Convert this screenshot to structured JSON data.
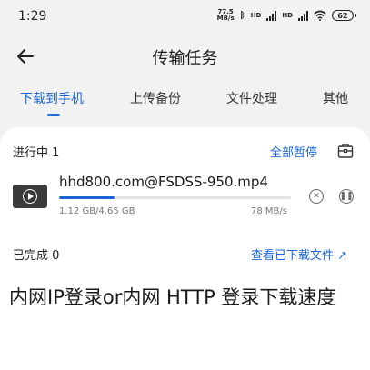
{
  "status_bar": {
    "time": "1:29",
    "net_speed_top": "77.5",
    "net_speed_bottom": "MB/s",
    "hd1": "HD",
    "hd2": "HD",
    "battery": "62"
  },
  "header": {
    "title": "传输任务",
    "back_icon": "arrow-left-icon"
  },
  "tabs": [
    {
      "label": "下载到手机",
      "active": true
    },
    {
      "label": "上传备份",
      "active": false
    },
    {
      "label": "文件处理",
      "active": false
    },
    {
      "label": "其他",
      "active": false
    }
  ],
  "in_progress": {
    "label": "进行中 1",
    "pause_all": "全部暂停",
    "toolbox_icon": "toolbox-icon"
  },
  "task": {
    "file_name": "hhd800.com@FSDSS-950.mp4",
    "size": "1.12 GB/4.65 GB",
    "speed": "78 MB/s",
    "progress": 0.241,
    "cancel_icon": "close-circle-icon",
    "pause_icon": "pause-circle-icon"
  },
  "completed": {
    "label": "已完成 0",
    "view_link": "查看已下载文件 ↗"
  },
  "caption": "内网IP登录or内网 HTTP 登录下载速度",
  "colors": {
    "accent": "#1a66d9",
    "background": "#f2f2f2",
    "card": "#ffffff"
  }
}
